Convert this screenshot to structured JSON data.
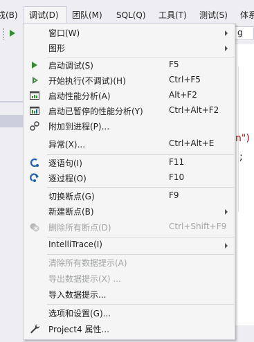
{
  "menubar": {
    "items": [
      {
        "label": "戍(B)"
      },
      {
        "label": "调试(D)"
      },
      {
        "label": "团队(M)"
      },
      {
        "label": "SQL(Q)"
      },
      {
        "label": "工具(T)"
      },
      {
        "label": "测试(S)"
      },
      {
        "label": "体系"
      }
    ]
  },
  "toolbar": {
    "config_combo_text": "g"
  },
  "editor": {
    "line1": "n\")",
    "line2": ";"
  },
  "menu": {
    "items": [
      {
        "label": "窗口(W)",
        "shortcut": ""
      },
      {
        "label": "图形",
        "shortcut": ""
      },
      {
        "label": "启动调试(S)",
        "shortcut": "F5"
      },
      {
        "label": "开始执行(不调试)(H)",
        "shortcut": "Ctrl+F5"
      },
      {
        "label": "启动性能分析(A)",
        "shortcut": "Alt+F2"
      },
      {
        "label": "启动已暂停的性能分析(Y)",
        "shortcut": "Ctrl+Alt+F2"
      },
      {
        "label": "附加到进程(P)...",
        "shortcut": ""
      },
      {
        "label": "异常(X)...",
        "shortcut": "Ctrl+Alt+E"
      },
      {
        "label": "逐语句(I)",
        "shortcut": "F11"
      },
      {
        "label": "逐过程(O)",
        "shortcut": "F10"
      },
      {
        "label": "切换断点(G)",
        "shortcut": "F9"
      },
      {
        "label": "新建断点(B)",
        "shortcut": ""
      },
      {
        "label": "删除所有断点(D)",
        "shortcut": "Ctrl+Shift+F9"
      },
      {
        "label": "IntelliTrace(I)",
        "shortcut": ""
      },
      {
        "label": "清除所有数据提示(A)",
        "shortcut": ""
      },
      {
        "label": "导出数据提示(X) ...",
        "shortcut": ""
      },
      {
        "label": "导入数据提示...",
        "shortcut": ""
      },
      {
        "label": "选项和设置(G)...",
        "shortcut": ""
      },
      {
        "label": "Project4 属性...",
        "shortcut": ""
      }
    ]
  },
  "colors": {
    "menu_bg": "#f5f5f5",
    "highlight": "#dfe3ea",
    "disabled_text": "#a2a4a5",
    "play_green": "#388a34",
    "step_blue": "#1e5fb4"
  }
}
